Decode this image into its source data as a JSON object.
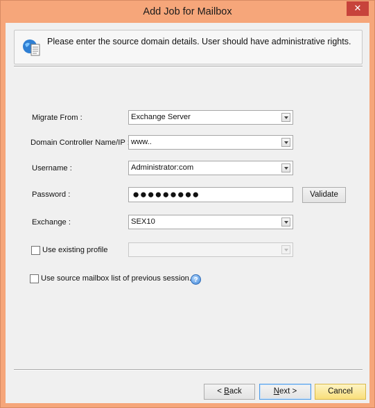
{
  "window": {
    "title": "Add Job for Mailbox",
    "close_label": "✕"
  },
  "info": {
    "message": "Please enter the source domain details. User should have administrative rights."
  },
  "form": {
    "migrate_from": {
      "label": "Migrate From :",
      "value": "Exchange Server"
    },
    "domain_controller": {
      "label": "Domain Controller Name/IP :",
      "value": "www.."
    },
    "username": {
      "label": "Username :",
      "value": "Administrator:com"
    },
    "password": {
      "label": "Password :",
      "value": "●●●●●●●●●",
      "validate_label": "Validate"
    },
    "exchange": {
      "label": "Exchange :",
      "value": "SEX10"
    },
    "existing_profile": {
      "label": "Use existing profile",
      "checked": false,
      "value": ""
    },
    "previous_session": {
      "label": "Use source mailbox list of previous session.",
      "checked": false
    }
  },
  "footer": {
    "back_prefix": "< ",
    "back_hot": "B",
    "back_rest": "ack",
    "next_hot": "N",
    "next_rest": "ext >",
    "cancel_label": "Cancel"
  },
  "icons": {
    "info": "document-globe-icon",
    "help": "question-icon",
    "dropdown": "chevron-down-icon"
  },
  "colors": {
    "window_frame": "#f6a67a",
    "close_button": "#c7433b",
    "primary_border": "#4f9be6",
    "cancel_fill": "#f9df7a"
  }
}
